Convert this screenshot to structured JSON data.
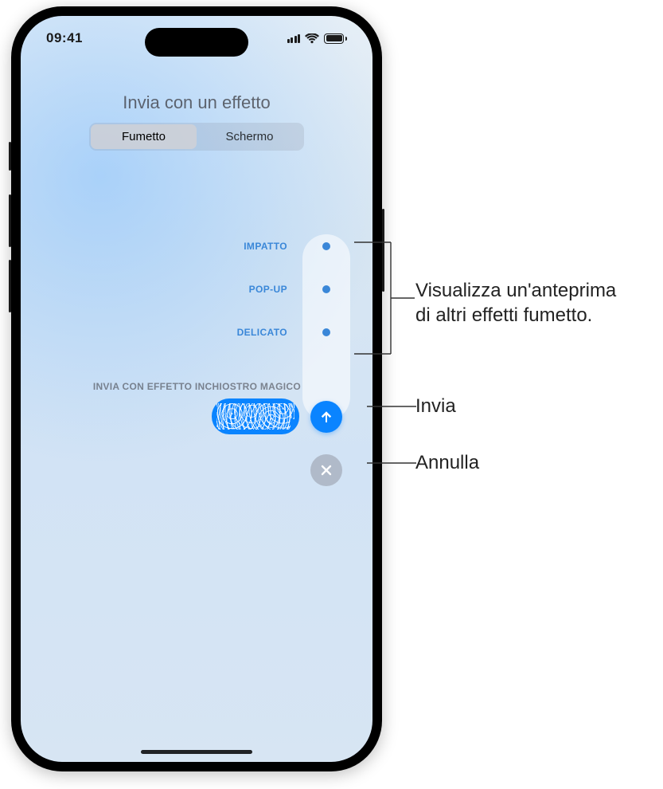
{
  "status": {
    "time": "09:41"
  },
  "title": "Invia con un effetto",
  "segmented": {
    "bubble": "Fumetto",
    "screen": "Schermo"
  },
  "effects": {
    "slam": "IMPATTO",
    "loud": "POP-UP",
    "gentle": "DELICATO",
    "invisible_hint": "INVIA CON EFFETTO INCHIOSTRO MAGICO"
  },
  "callouts": {
    "preview_line1": "Visualizza un'anteprima",
    "preview_line2": "di altri effetti fumetto.",
    "send": "Invia",
    "cancel": "Annulla"
  }
}
